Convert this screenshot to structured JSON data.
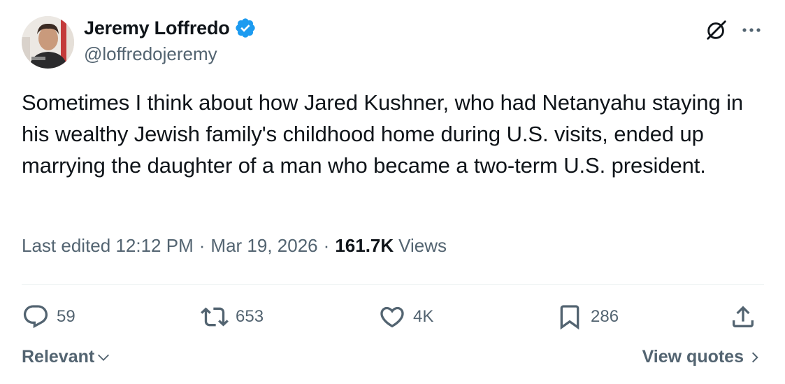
{
  "author": {
    "display_name": "Jeremy Loffredo",
    "handle": "@loffredojeremy",
    "verified_icon": "verified-badge-icon",
    "badge_color": "#1d9bf0"
  },
  "tweet": {
    "text": "Sometimes I think about how Jared Kushner, who had Netanyahu staying in his wealthy Jewish family's childhood home during U.S. visits, ended up marrying the daughter of a man who became a two-term U.S. president."
  },
  "meta": {
    "edited_label": "Last edited",
    "time": "12:12 PM",
    "date": "Mar 19, 2026",
    "views_count": "161.7K",
    "views_label": "Views",
    "separator": "·"
  },
  "actions": {
    "replies": "59",
    "reposts": "653",
    "likes": "4K",
    "bookmarks": "286"
  },
  "footer": {
    "sort_label": "Relevant",
    "view_quotes_label": "View quotes"
  },
  "colors": {
    "text_primary": "#0f1419",
    "text_secondary": "#536471",
    "divider": "#eff3f4"
  }
}
